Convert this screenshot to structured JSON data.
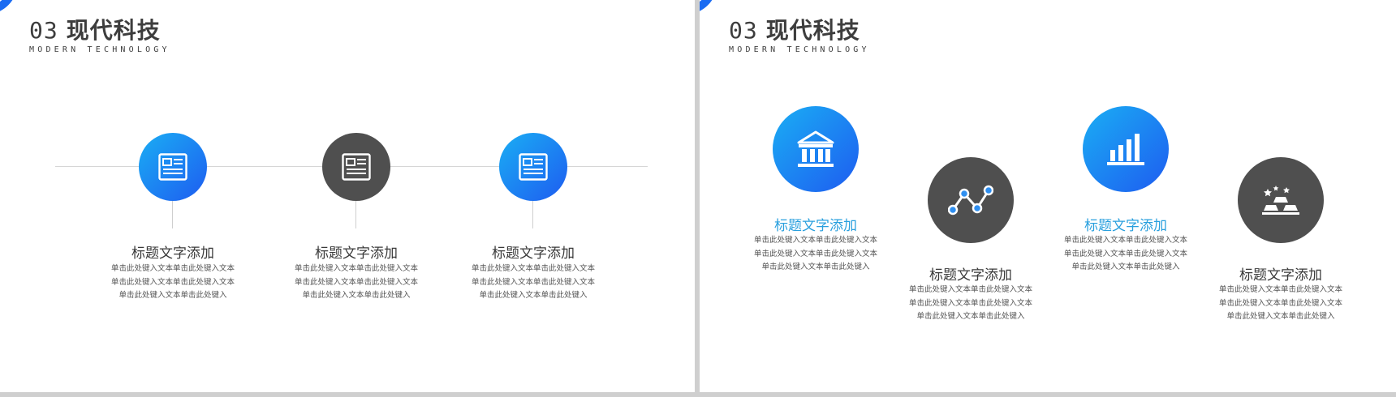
{
  "colors": {
    "accent_blue": "#1e5cf0",
    "accent_cyan": "#1aaef4",
    "dark_gray": "#4f4f4f",
    "title_accent": "#2aa0de"
  },
  "slide1": {
    "title_number": "03",
    "title": "现代科技",
    "subtitle": "MODERN TECHNOLOGY",
    "items": [
      {
        "icon": "document-icon",
        "title": "标题文字添加",
        "lines": [
          "单击此处键入文本单击此处键入文本",
          "单击此处键入文本单击此处键入文本",
          "单击此处键入文本单击此处键入"
        ]
      },
      {
        "icon": "document-icon",
        "title": "标题文字添加",
        "lines": [
          "单击此处键入文本单击此处键入文本",
          "单击此处键入文本单击此处键入文本",
          "单击此处键入文本单击此处键入"
        ]
      },
      {
        "icon": "document-icon",
        "title": "标题文字添加",
        "lines": [
          "单击此处键入文本单击此处键入文本",
          "单击此处键入文本单击此处键入文本",
          "单击此处键入文本单击此处键入"
        ]
      }
    ]
  },
  "slide2": {
    "title_number": "03",
    "title": "现代科技",
    "subtitle": "MODERN TECHNOLOGY",
    "items": [
      {
        "icon": "bank-icon",
        "title": "标题文字添加",
        "lines": [
          "单击此处键入文本单击此处键入文本",
          "单击此处键入文本单击此处键入文本",
          "单击此处键入文本单击此处键入"
        ]
      },
      {
        "icon": "line-chart-icon",
        "title": "标题文字添加",
        "lines": [
          "单击此处键入文本单击此处键入文本",
          "单击此处键入文本单击此处键入文本",
          "单击此处键入文本单击此处键入"
        ]
      },
      {
        "icon": "bar-chart-icon",
        "title": "标题文字添加",
        "lines": [
          "单击此处键入文本单击此处键入文本",
          "单击此处键入文本单击此处键入文本",
          "单击此处键入文本单击此处键入"
        ]
      },
      {
        "icon": "gold-bars-icon",
        "title": "标题文字添加",
        "lines": [
          "单击此处键入文本单击此处键入文本",
          "单击此处键入文本单击此处键入文本",
          "单击此处键入文本单击此处键入"
        ]
      }
    ]
  }
}
